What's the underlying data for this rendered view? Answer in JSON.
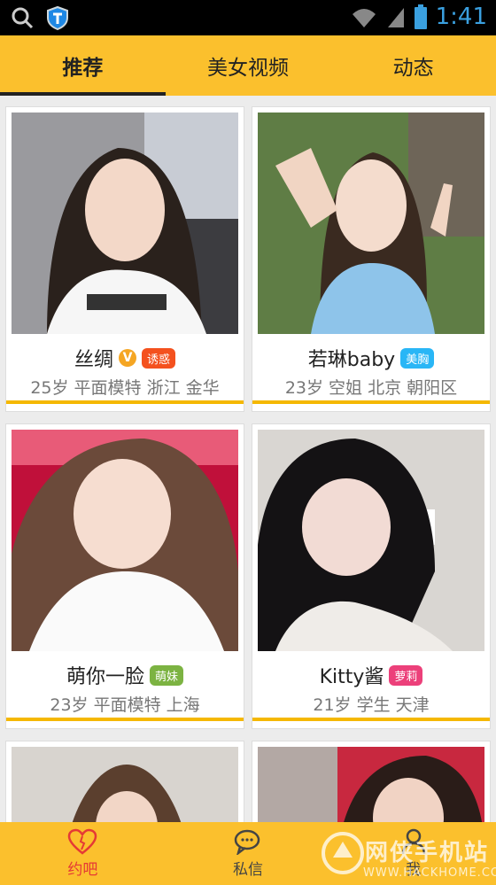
{
  "status_bar": {
    "time": "1:41"
  },
  "tabs": [
    {
      "label": "推荐",
      "active": true
    },
    {
      "label": "美女视频",
      "active": false
    },
    {
      "label": "动态",
      "active": false
    }
  ],
  "cards": [
    {
      "name": "丝绸",
      "verified": true,
      "verified_mark": "V",
      "tag": "诱惑",
      "tag_color": "#f4511e",
      "info": "25岁 平面模特 浙江 金华"
    },
    {
      "name": "若琳baby",
      "verified": false,
      "tag": "美胸",
      "tag_color": "#29b6f6",
      "info": "23岁 空姐 北京 朝阳区"
    },
    {
      "name": "萌你一脸",
      "verified": false,
      "tag": "萌妹",
      "tag_color": "#7cb342",
      "info": "23岁 平面模特 上海"
    },
    {
      "name": "Kitty酱",
      "verified": false,
      "tag": "萝莉",
      "tag_color": "#ec407a",
      "info": "21岁 学生 天津"
    }
  ],
  "bottom_nav": [
    {
      "label": "约吧",
      "icon": "heart-icon",
      "active": true
    },
    {
      "label": "私信",
      "icon": "chat-bubble-icon",
      "active": false
    },
    {
      "label": "我",
      "icon": "person-icon",
      "active": false
    }
  ],
  "watermark": {
    "text": "网侠手机站",
    "url": "WWW.HACKHOME.COM"
  }
}
